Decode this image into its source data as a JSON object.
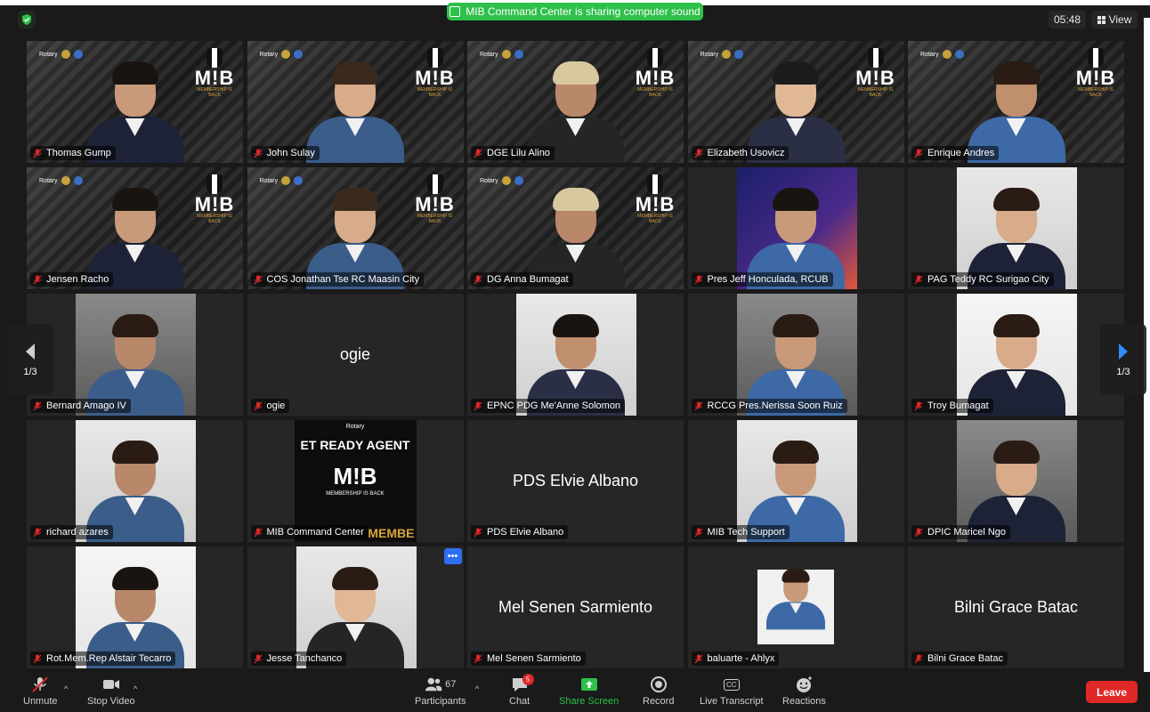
{
  "top_bar": {
    "share_banner": "MIB Command Center is sharing computer sound",
    "timer": "05:48",
    "view_label": "View"
  },
  "navigation": {
    "page_left": "1/3",
    "page_right": "1/3"
  },
  "tile_texts": {
    "rotary": "Rotary",
    "mib_word": "M!B",
    "mib_sub": "MEMBERSHIP IS BACK",
    "mib_poster_top": "ET READY AGENT",
    "mib_poster_bottom": "MEMBE",
    "more_dots": "•••"
  },
  "participants": [
    {
      "name": "Thomas Gump",
      "type": "mib"
    },
    {
      "name": "John Sulay",
      "type": "mib"
    },
    {
      "name": "DGE Lilu Alino",
      "type": "mib"
    },
    {
      "name": "Elizabeth Usovicz",
      "type": "mib"
    },
    {
      "name": "Enrique Andres",
      "type": "mib"
    },
    {
      "name": "Jensen Racho",
      "type": "mib"
    },
    {
      "name": "COS Jonathan Tse RC Maasin City",
      "type": "mib"
    },
    {
      "name": "DG Anna Bumagat",
      "type": "mib"
    },
    {
      "name": "Pres Jeff Honculada, RCUB",
      "type": "photo"
    },
    {
      "name": "PAG Teddy RC Surigao City",
      "type": "photo"
    },
    {
      "name": "Bernard Amago IV",
      "type": "photo"
    },
    {
      "name": "ogie",
      "type": "name",
      "big": "ogie"
    },
    {
      "name": "EPNC PDG Me'Anne Solomon",
      "type": "photo"
    },
    {
      "name": "RCCG Pres.Nerissa Soon Ruiz",
      "type": "photo"
    },
    {
      "name": "Troy Bumagat",
      "type": "photo"
    },
    {
      "name": "richard azares",
      "type": "photo"
    },
    {
      "name": "MIB Command Center",
      "type": "poster"
    },
    {
      "name": "PDS Elvie Albano",
      "type": "name",
      "big": "PDS Elvie Albano"
    },
    {
      "name": "MIB Tech Support",
      "type": "photo"
    },
    {
      "name": "DPIC Maricel Ngo",
      "type": "photo"
    },
    {
      "name": "Rot.Mem.Rep Alstair Tecarro",
      "type": "photo"
    },
    {
      "name": "Jesse Tanchanco",
      "type": "photo"
    },
    {
      "name": "Mel Senen Sarmiento",
      "type": "name",
      "big": "Mel Senen Sarmiento"
    },
    {
      "name": "baluarte - Ahlyx",
      "type": "photo"
    },
    {
      "name": "Bilni Grace Batac",
      "type": "name",
      "big": "Bilni Grace Batac"
    }
  ],
  "toolbar": {
    "unmute": "Unmute",
    "stop_video": "Stop Video",
    "participants": "Participants",
    "participants_count": "67",
    "chat": "Chat",
    "chat_badge": "5",
    "share_screen": "Share Screen",
    "record": "Record",
    "live_transcript": "Live Transcript",
    "cc": "CC",
    "reactions": "Reactions",
    "leave": "Leave"
  },
  "colors": {
    "accent_green": "#2ec04a",
    "leave_red": "#e02828",
    "more_blue": "#2d6ff2",
    "tile_bg": "#262626"
  }
}
